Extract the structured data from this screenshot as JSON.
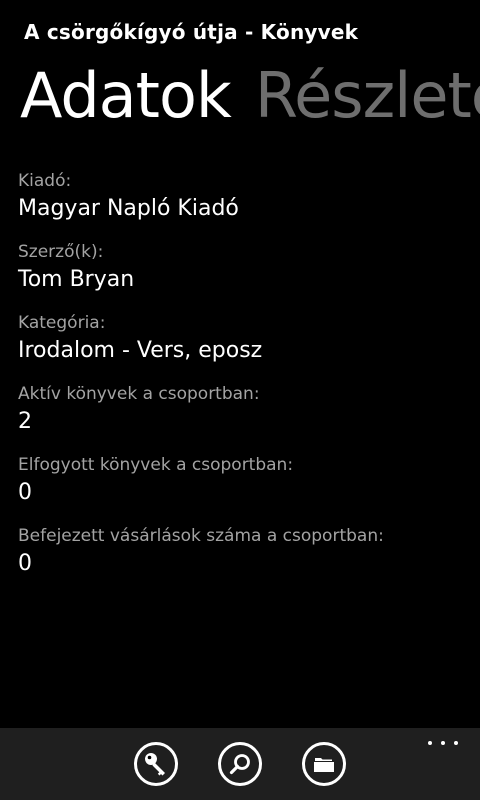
{
  "app": {
    "title": "A csörgőkígyó útja - Könyvek"
  },
  "pivot": {
    "items": [
      {
        "label": "Adatok",
        "active": true
      },
      {
        "label": "Részletek",
        "active": false
      }
    ]
  },
  "details": {
    "fields": [
      {
        "label": "Kiadó:",
        "value": "Magyar Napló Kiadó"
      },
      {
        "label": "Szerző(k):",
        "value": "Tom Bryan"
      },
      {
        "label": "Kategória:",
        "value": "Irodalom - Vers, eposz"
      },
      {
        "label": "Aktív könyvek a csoportban:",
        "value": "2"
      },
      {
        "label": "Elfogyott könyvek a csoportban:",
        "value": "0"
      },
      {
        "label": "Befejezett vásárlások száma a csoportban:",
        "value": "0"
      }
    ]
  },
  "app_bar": {
    "buttons": [
      {
        "icon": "key-icon"
      },
      {
        "icon": "search-icon"
      },
      {
        "icon": "folder-icon"
      }
    ],
    "more_icon": "more-icon"
  },
  "colors": {
    "background": "#000000",
    "label": "#a3a3a3",
    "inactive_header": "#6e6e6e",
    "app_bar": "#1f1f1f"
  }
}
